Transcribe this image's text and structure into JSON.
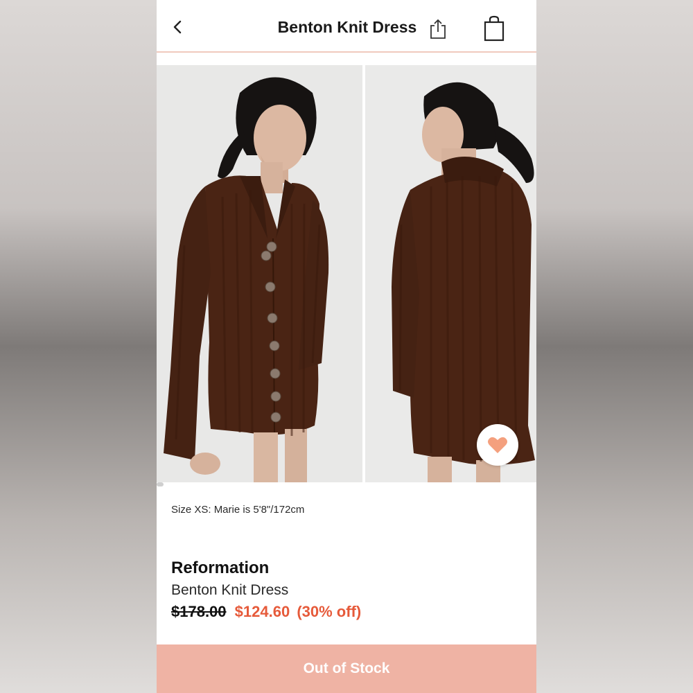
{
  "header": {
    "title": "Benton Knit Dress",
    "back_icon": "chevron-left-icon",
    "share_icon": "share-icon",
    "bag_icon": "shopping-bag-icon"
  },
  "gallery": {
    "images": [
      {
        "name": "product-photo-front",
        "description_visible": ""
      },
      {
        "name": "product-photo-back",
        "description_visible": ""
      }
    ],
    "favorite_icon": "heart-icon",
    "favorite_color": "#f4a07e"
  },
  "details": {
    "size_note": "Size XS: Marie is 5'8\"/172cm",
    "brand": "Reformation",
    "name": "Benton Knit Dress",
    "original_price": "$178.00",
    "sale_price": "$124.60",
    "discount": "(30% off)"
  },
  "cta": {
    "label": "Out of Stock",
    "color": "#efb3a4"
  },
  "colors": {
    "accent": "#e65a3a",
    "dress": "#4a2414"
  }
}
